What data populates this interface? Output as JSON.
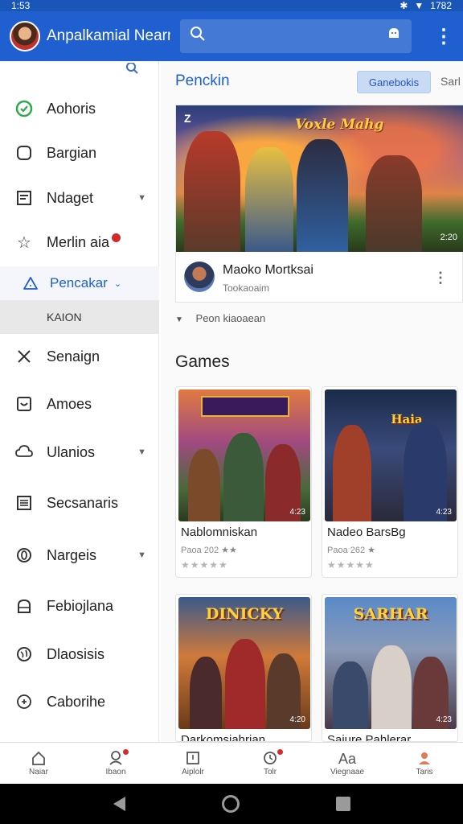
{
  "status_bar": {
    "time": "1:53",
    "right_text": "1782"
  },
  "app_bar": {
    "title": "Anpalkamial Nearn",
    "search_placeholder": ""
  },
  "sidebar": {
    "items": [
      {
        "label": "Aohoris",
        "icon": "check-circle-icon"
      },
      {
        "label": "Bargian",
        "icon": "rounded-square-icon"
      },
      {
        "label": "Ndaget",
        "icon": "list-box-icon",
        "expandable": true
      },
      {
        "label": "Merlin aia",
        "icon": "star-outline-icon",
        "badge": true
      },
      {
        "label": "Pencakar",
        "icon": "alert-triangle-icon",
        "active": true
      },
      {
        "label": "KAION",
        "section": true
      },
      {
        "label": "Senaign",
        "icon": "tools-icon"
      },
      {
        "label": "Amoes",
        "icon": "smile-box-icon"
      },
      {
        "label": "Ulanios",
        "icon": "cloud-chat-icon",
        "expandable": true
      },
      {
        "label": "Secsanaris",
        "icon": "document-icon"
      },
      {
        "label": "Nargeis",
        "icon": "circle-zero-icon",
        "expandable": true
      },
      {
        "label": "Febiojlana",
        "icon": "home-outline-icon"
      },
      {
        "label": "Dlaosisis",
        "icon": "globe-icon"
      },
      {
        "label": "Caborihe",
        "icon": "plus-circle-icon"
      }
    ]
  },
  "main": {
    "heading": "Penckin",
    "chip_label": "Ganebokis",
    "chip_trailing": "Sarl",
    "featured": {
      "title": "Maoko Mortksai",
      "subtitle": "Tookaoaim",
      "art_title": "Voxle Mahg",
      "art_logo": "Z",
      "duration": "2:20"
    },
    "expand_label": "Peon kiaoaean",
    "games_heading": "Games",
    "games": [
      {
        "name": "Nablomniskan",
        "meta": "Paoa 202",
        "tag": "4:23",
        "art_text": "",
        "rating": 0
      },
      {
        "name": "Nadeo BarsBg",
        "meta": "Paoa 262",
        "tag": "4:23",
        "art_text": "Haia",
        "rating": 0
      },
      {
        "name": "Darkomsiahrian",
        "meta": "",
        "tag": "4:20",
        "art_text": "DINICKY",
        "rating": 0
      },
      {
        "name": "Saiure Pahlerar",
        "meta": "",
        "tag": "4:23",
        "art_text": "SARHAR",
        "rating": 0
      }
    ]
  },
  "bottom_nav": [
    {
      "label": "Naiar",
      "icon": "home-icon"
    },
    {
      "label": "Ibaon",
      "icon": "person-alert-icon",
      "badge": true
    },
    {
      "label": "Aiplolr",
      "icon": "book-icon"
    },
    {
      "label": "Tolr",
      "icon": "clock-alert-icon",
      "badge": true
    },
    {
      "label": "Viegnaae",
      "icon": "aa-text-icon",
      "icon_text": "Aa"
    },
    {
      "label": "Taris",
      "icon": "profile-icon"
    }
  ],
  "colors": {
    "accent": "#1f5fd0",
    "badge": "#d42a2a"
  }
}
